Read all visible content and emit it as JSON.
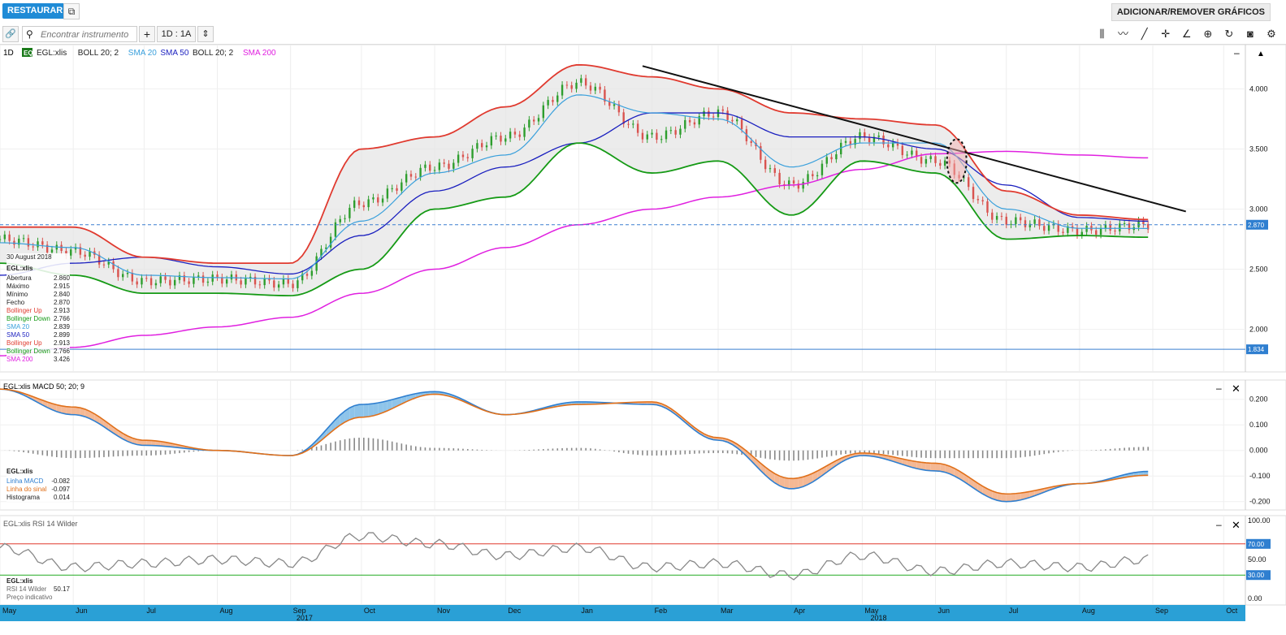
{
  "topbar": {
    "restore_label": "RESTAURAR",
    "add_remove_label": "ADICIONAR/REMOVER GRÁFICOS"
  },
  "toolbar": {
    "search_placeholder": "Encontrar instrumento",
    "period_label": "1D : 1A"
  },
  "price_panel": {
    "interval": "1D",
    "badge": "EQ",
    "legend": [
      {
        "label": "EGL:xlis",
        "color": "#222222"
      },
      {
        "label": "BOLL 20; 2",
        "color": "#222222"
      },
      {
        "label": "SMA 20",
        "color": "#3aa0dc"
      },
      {
        "label": "SMA 50",
        "color": "#1a1fbf"
      },
      {
        "label": "BOLL 20; 2",
        "color": "#222222"
      },
      {
        "label": "SMA 200",
        "color": "#e020e0"
      }
    ],
    "axis_ticks": [
      "4.000",
      "3.500",
      "3.000",
      "2.500",
      "2.000"
    ],
    "last_price_label": "2.870",
    "low_label": "1.834",
    "tooltip": {
      "date": "30 August 2018",
      "instrument": "EGL:xlis",
      "rows": [
        {
          "k": "Abertura",
          "v": "2.860",
          "c": "#222222"
        },
        {
          "k": "Máximo",
          "v": "2.915",
          "c": "#222222"
        },
        {
          "k": "Mínimo",
          "v": "2.840",
          "c": "#222222"
        },
        {
          "k": "Fecho",
          "v": "2.870",
          "c": "#222222"
        },
        {
          "k": "Bollinger Up",
          "v": "2.913",
          "c": "#e03a2f"
        },
        {
          "k": "Bollinger Down",
          "v": "2.766",
          "c": "#159a15"
        },
        {
          "k": "SMA 20",
          "v": "2.839",
          "c": "#3aa0dc"
        },
        {
          "k": "SMA 50",
          "v": "2.899",
          "c": "#1a1fbf"
        },
        {
          "k": "Bollinger Up",
          "v": "2.913",
          "c": "#e03a2f"
        },
        {
          "k": "Bollinger Down",
          "v": "2.766",
          "c": "#159a15"
        },
        {
          "k": "SMA 200",
          "v": "3.426",
          "c": "#e020e0"
        }
      ]
    }
  },
  "macd_panel": {
    "title": "EGL:xlis  MACD 50; 20; 9",
    "axis_ticks": [
      "0.200",
      "0.100",
      "0.000",
      "-0.100",
      "-0.200"
    ],
    "tooltip": {
      "instrument": "EGL:xlis",
      "rows": [
        {
          "k": "Linha MACD",
          "v": "-0.082",
          "c": "#2f7fd0"
        },
        {
          "k": "Linha do sinal",
          "v": "-0.097",
          "c": "#e0701a"
        },
        {
          "k": "Histograma",
          "v": "0.014",
          "c": "#222222"
        }
      ]
    }
  },
  "rsi_panel": {
    "title": "EGL:xlis  RSI 14 Wilder",
    "axis_ticks": [
      "100.00",
      "70.00",
      "50.00",
      "30.00",
      "0.00"
    ],
    "tooltip": {
      "instrument": "EGL:xlis",
      "rows": [
        {
          "k": "RSI 14 Wilder",
          "v": "50.17"
        },
        {
          "k": "Preço indicativo",
          "v": ""
        }
      ]
    }
  },
  "time_axis": {
    "months": [
      "May",
      "Jun",
      "Jul",
      "Aug",
      "Sep",
      "Oct",
      "Nov",
      "Dec",
      "Jan",
      "Feb",
      "Mar",
      "Apr",
      "May",
      "Jun",
      "Jul",
      "Aug",
      "Sep",
      "Oct"
    ],
    "years": [
      "2017",
      "2018"
    ]
  },
  "colors": {
    "boll_up": "#e03a2f",
    "boll_down": "#159a15",
    "sma20": "#3aa0dc",
    "sma50": "#1a1fbf",
    "sma200": "#e020e0",
    "candle_up": "#2e9e2e",
    "candle_down": "#d9534f",
    "macd": "#2f7fd0",
    "signal": "#e0701a",
    "rsi": "#888888",
    "rsi_upper": "#e03a2f",
    "rsi_lower": "#22aa22",
    "axis_bar": "#2aa0d6"
  },
  "chart_data": [
    {
      "type": "line",
      "title": "",
      "x": [
        "2017-05-01",
        "2017-06-01",
        "2017-07-01",
        "2017-08-01",
        "2017-09-01",
        "2017-10-01",
        "2017-11-01",
        "2017-12-01",
        "2018-01-01",
        "2018-02-01",
        "2018-03-01",
        "2018-04-01",
        "2018-05-01",
        "2018-06-01",
        "2018-07-01",
        "2018-08-01",
        "2018-08-30"
      ],
      "ylim": [
        1.7,
        4.3
      ],
      "series": [
        {
          "name": "EGL:xlis",
          "values": [
            2.75,
            2.65,
            2.4,
            2.42,
            2.38,
            3.05,
            3.35,
            3.6,
            4.05,
            3.6,
            3.8,
            3.2,
            3.6,
            3.4,
            2.9,
            2.82,
            2.87
          ]
        },
        {
          "name": "SMA 20",
          "values": [
            2.72,
            2.68,
            2.45,
            2.43,
            2.42,
            2.9,
            3.3,
            3.45,
            3.95,
            3.8,
            3.75,
            3.35,
            3.55,
            3.55,
            3.0,
            2.84,
            2.839
          ]
        },
        {
          "name": "SMA 50",
          "values": [
            2.45,
            2.55,
            2.6,
            2.52,
            2.46,
            2.78,
            3.15,
            3.35,
            3.55,
            3.8,
            3.8,
            3.6,
            3.6,
            3.5,
            3.2,
            2.93,
            2.899
          ]
        },
        {
          "name": "SMA 200",
          "values": [
            1.78,
            1.85,
            1.95,
            2.02,
            2.1,
            2.3,
            2.5,
            2.68,
            2.87,
            3.0,
            3.1,
            3.2,
            3.33,
            3.46,
            3.48,
            3.45,
            3.426
          ]
        },
        {
          "name": "Bollinger Up",
          "values": [
            2.85,
            2.85,
            2.6,
            2.55,
            2.55,
            3.5,
            3.6,
            3.85,
            4.2,
            4.1,
            4.0,
            3.8,
            3.75,
            3.7,
            3.15,
            2.95,
            2.913
          ]
        },
        {
          "name": "Bollinger Down",
          "values": [
            2.55,
            2.45,
            2.3,
            2.3,
            2.28,
            2.5,
            3.0,
            3.1,
            3.55,
            3.3,
            3.4,
            2.95,
            3.4,
            3.3,
            2.75,
            2.78,
            2.766
          ]
        }
      ]
    },
    {
      "type": "line",
      "title": "",
      "x": [
        "2017-05-01",
        "2017-06-01",
        "2017-07-01",
        "2017-08-01",
        "2017-09-01",
        "2017-10-01",
        "2017-11-01",
        "2017-12-01",
        "2018-01-01",
        "2018-02-01",
        "2018-03-01",
        "2018-04-01",
        "2018-05-01",
        "2018-06-01",
        "2018-07-01",
        "2018-08-01",
        "2018-08-30"
      ],
      "ylim": [
        -0.22,
        0.25
      ],
      "series": [
        {
          "name": "Linha MACD",
          "values": [
            0.24,
            0.14,
            0.02,
            0.0,
            -0.02,
            0.18,
            0.23,
            0.14,
            0.19,
            0.18,
            0.04,
            -0.15,
            -0.02,
            -0.08,
            -0.2,
            -0.13,
            -0.082
          ]
        },
        {
          "name": "Linha do sinal",
          "values": [
            0.24,
            0.17,
            0.04,
            0.0,
            -0.02,
            0.13,
            0.22,
            0.14,
            0.18,
            0.19,
            0.05,
            -0.11,
            -0.01,
            -0.05,
            -0.17,
            -0.13,
            -0.097
          ]
        },
        {
          "name": "Histograma",
          "values": [
            0.0,
            -0.03,
            -0.02,
            0.0,
            0.0,
            0.05,
            0.01,
            0.0,
            0.01,
            -0.02,
            -0.01,
            -0.04,
            -0.01,
            -0.03,
            -0.03,
            0.0,
            0.014
          ]
        }
      ]
    },
    {
      "type": "line",
      "title": "",
      "x": [
        "2017-05-01",
        "2017-06-01",
        "2017-07-01",
        "2017-08-01",
        "2017-09-01",
        "2017-10-01",
        "2017-11-01",
        "2017-12-01",
        "2018-01-01",
        "2018-02-01",
        "2018-03-01",
        "2018-04-01",
        "2018-05-01",
        "2018-06-01",
        "2018-07-01",
        "2018-08-01",
        "2018-08-30"
      ],
      "ylim": [
        0,
        100
      ],
      "series": [
        {
          "name": "RSI 14 Wilder",
          "values": [
            65,
            40,
            45,
            50,
            45,
            80,
            70,
            55,
            65,
            40,
            45,
            30,
            55,
            35,
            45,
            40,
            50.17
          ]
        }
      ]
    }
  ]
}
